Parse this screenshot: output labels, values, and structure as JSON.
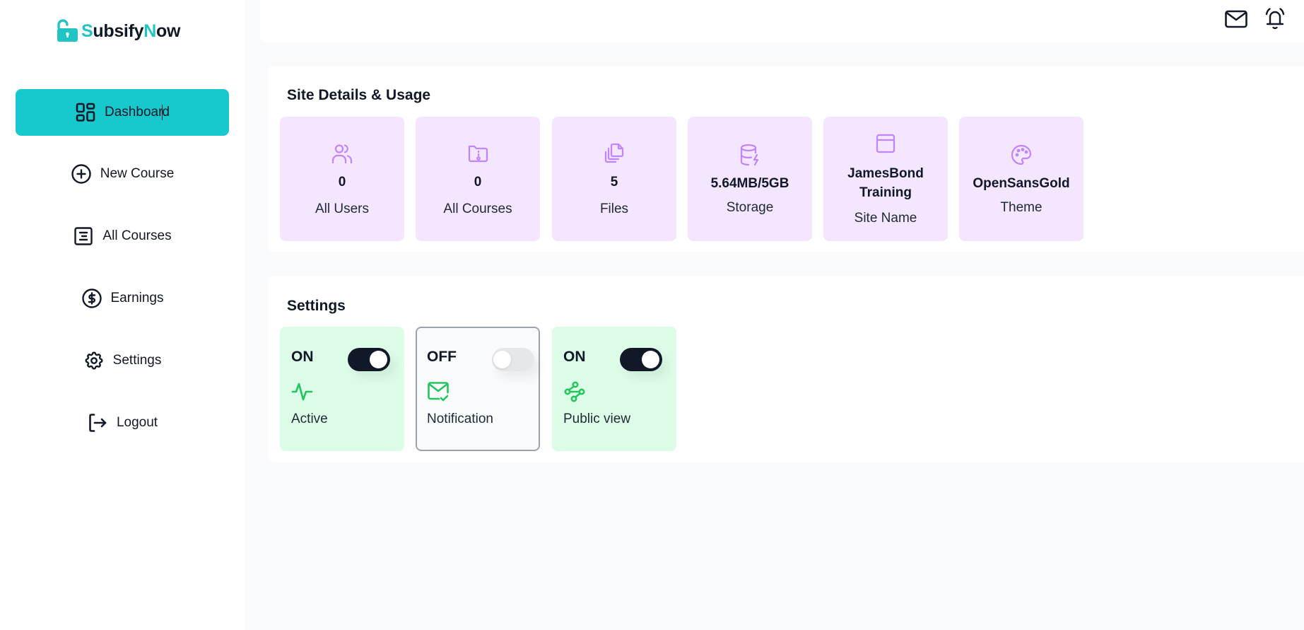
{
  "brand": {
    "name_prefix": "S",
    "name_mid": "ubsify",
    "name_accent": "N",
    "name_suffix": "ow",
    "accent_color": "#20c4c4"
  },
  "sidebar": {
    "items": [
      {
        "label": "Dashboard",
        "icon": "dashboard-grid-icon",
        "active": true
      },
      {
        "label": "New Course",
        "icon": "plus-circle-icon",
        "active": false
      },
      {
        "label": "All Courses",
        "icon": "list-box-icon",
        "active": false
      },
      {
        "label": "Earnings",
        "icon": "dollar-circle-icon",
        "active": false
      },
      {
        "label": "Settings",
        "icon": "gear-icon",
        "active": false
      },
      {
        "label": "Logout",
        "icon": "logout-icon",
        "active": false
      }
    ],
    "active_color": "#17c9cd"
  },
  "header": {
    "icons": [
      "mail-icon",
      "bell-ringing-icon"
    ]
  },
  "site_details": {
    "title": "Site Details & Usage",
    "stats": [
      {
        "value": "0",
        "label": "All Users",
        "icon": "users-icon"
      },
      {
        "value": "0",
        "label": "All Courses",
        "icon": "folder-icon"
      },
      {
        "value": "5",
        "label": "Files",
        "icon": "files-icon"
      },
      {
        "value": "5.64MB/5GB",
        "label": "Storage",
        "icon": "database-bolt-icon"
      },
      {
        "value_line1": "JamesBond",
        "value_line2": "Training",
        "label": "Site Name",
        "icon": "browser-window-icon"
      },
      {
        "value": "OpenSansGold",
        "label": "Theme",
        "icon": "palette-icon"
      }
    ],
    "card_color": "#f3e6fe",
    "icon_color": "#c084fc"
  },
  "settings": {
    "title": "Settings",
    "items": [
      {
        "state": "ON",
        "enabled": true,
        "label": "Active",
        "icon": "activity-pulse-icon"
      },
      {
        "state": "OFF",
        "enabled": false,
        "label": "Notification",
        "icon": "mail-check-icon"
      },
      {
        "state": "ON",
        "enabled": true,
        "label": "Public view",
        "icon": "share-nodes-icon"
      }
    ],
    "on_color": "#dcfce7",
    "icon_color": "#22c55e"
  }
}
